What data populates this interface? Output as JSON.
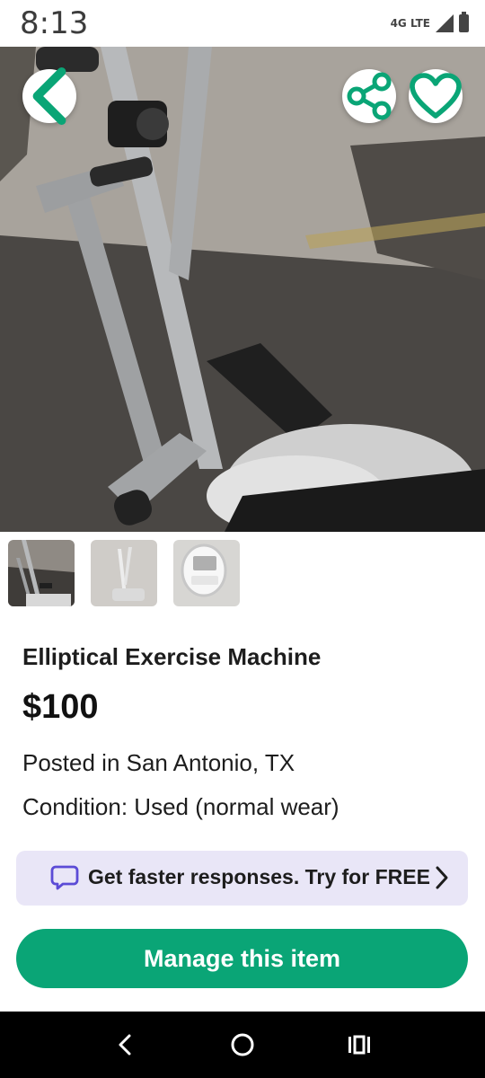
{
  "status_bar": {
    "time": "8:13",
    "network": "4G LTE",
    "icons": [
      "lte-icon",
      "signal-icon",
      "battery-icon"
    ]
  },
  "hero": {
    "icons": [
      "back-arrow-icon",
      "share-icon",
      "heart-icon"
    ]
  },
  "listing": {
    "title": "Elliptical Exercise Machine",
    "price": "$100",
    "location": "Posted in San Antonio, TX",
    "condition": "Condition: Used (normal wear)"
  },
  "promo": {
    "text": "Get faster responses. Try for FREE",
    "icon": "chat-bubble-icon"
  },
  "actions": {
    "manage_label": "Manage this item"
  },
  "colors": {
    "accent": "#0aa576",
    "promo_bg": "#e9e6f7",
    "promo_icon": "#5b4bd6"
  }
}
